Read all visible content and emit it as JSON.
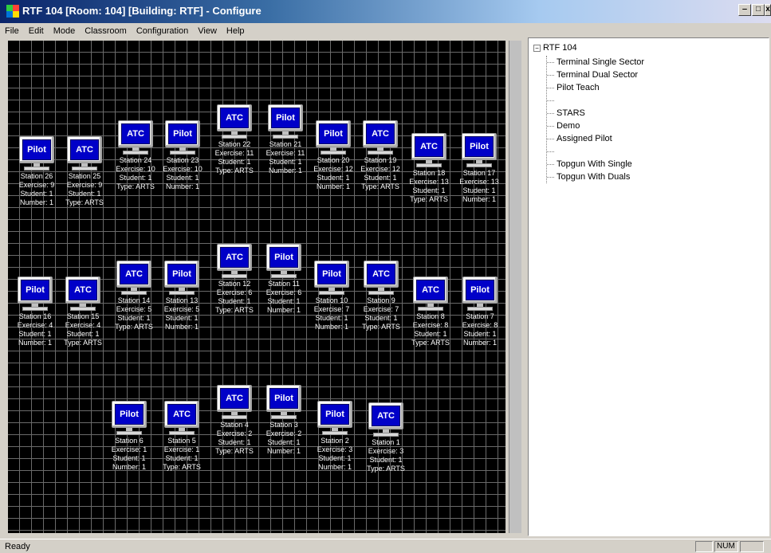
{
  "window": {
    "title": "RTF 104 [Room: 104] [Building: RTF] - Configure"
  },
  "menu": [
    "File",
    "Edit",
    "Mode",
    "Classroom",
    "Configuration",
    "View",
    "Help"
  ],
  "colors": {
    "screen": "#0000c8",
    "grid_background": "#000000",
    "grid_lines": "#6a6a6a"
  },
  "stations": [
    {
      "label": "Pilot",
      "name": "Station 26",
      "line1": "Exercise: 9",
      "line2": "Student: 1",
      "line3": "Number: 1"
    },
    {
      "label": "ATC",
      "name": "Station 25",
      "line1": "Exercise: 9",
      "line2": "Student: 1",
      "line3": "Type: ARTS"
    },
    {
      "label": "ATC",
      "name": "Station 24",
      "line1": "Exercise: 10",
      "line2": "Student: 1",
      "line3": "Type: ARTS"
    },
    {
      "label": "Pilot",
      "name": "Station 23",
      "line1": "Exercise: 10",
      "line2": "Student: 1",
      "line3": "Number: 1"
    },
    {
      "label": "ATC",
      "name": "Station 22",
      "line1": "Exercise: 11",
      "line2": "Student: 1",
      "line3": "Type: ARTS"
    },
    {
      "label": "Pilot",
      "name": "Station 21",
      "line1": "Exercise: 11",
      "line2": "Student: 1",
      "line3": "Number: 1"
    },
    {
      "label": "Pilot",
      "name": "Station 20",
      "line1": "Exercise: 12",
      "line2": "Student: 1",
      "line3": "Number: 1"
    },
    {
      "label": "ATC",
      "name": "Station 19",
      "line1": "Exercise: 12",
      "line2": "Student: 1",
      "line3": "Type: ARTS"
    },
    {
      "label": "ATC",
      "name": "Station 18",
      "line1": "Exercise: 13",
      "line2": "Student: 1",
      "line3": "Type: ARTS"
    },
    {
      "label": "Pilot",
      "name": "Station 17",
      "line1": "Exercise: 13",
      "line2": "Student: 1",
      "line3": "Number: 1"
    },
    {
      "label": "Pilot",
      "name": "Station 16",
      "line1": "Exercise: 4",
      "line2": "Student: 1",
      "line3": "Number: 1"
    },
    {
      "label": "ATC",
      "name": "Station 15",
      "line1": "Exercise: 4",
      "line2": "Student: 1",
      "line3": "Type: ARTS"
    },
    {
      "label": "ATC",
      "name": "Station 14",
      "line1": "Exercise: 5",
      "line2": "Student: 1",
      "line3": "Type: ARTS"
    },
    {
      "label": "Pilot",
      "name": "Station 13",
      "line1": "Exercise: 5",
      "line2": "Student: 1",
      "line3": "Number: 1"
    },
    {
      "label": "ATC",
      "name": "Station 12",
      "line1": "Exercise: 6",
      "line2": "Student: 1",
      "line3": "Type: ARTS"
    },
    {
      "label": "Pilot",
      "name": "Station 11",
      "line1": "Exercise: 6",
      "line2": "Student: 1",
      "line3": "Number: 1"
    },
    {
      "label": "Pilot",
      "name": "Station 10",
      "line1": "Exercise: 7",
      "line2": "Student: 1",
      "line3": "Number: 1"
    },
    {
      "label": "ATC",
      "name": "Station 9",
      "line1": "Exercise: 7",
      "line2": "Student: 1",
      "line3": "Type: ARTS"
    },
    {
      "label": "ATC",
      "name": "Station 8",
      "line1": "Exercise: 8",
      "line2": "Student: 1",
      "line3": "Type: ARTS"
    },
    {
      "label": "Pilot",
      "name": "Station 7",
      "line1": "Exercise: 8",
      "line2": "Student: 1",
      "line3": "Number: 1"
    },
    {
      "label": "Pilot",
      "name": "Station 6",
      "line1": "Exercise: 1",
      "line2": "Student: 1",
      "line3": "Number: 1"
    },
    {
      "label": "ATC",
      "name": "Station 5",
      "line1": "Exercise: 1",
      "line2": "Student: 1",
      "line3": "Type: ARTS"
    },
    {
      "label": "ATC",
      "name": "Station 4",
      "line1": "Exercise: 2",
      "line2": "Student: 1",
      "line3": "Type: ARTS"
    },
    {
      "label": "Pilot",
      "name": "Station 3",
      "line1": "Exercise: 2",
      "line2": "Student: 1",
      "line3": "Number: 1"
    },
    {
      "label": "Pilot",
      "name": "Station 2",
      "line1": "Exercise: 3",
      "line2": "Student: 1",
      "line3": "Number: 1"
    },
    {
      "label": "ATC",
      "name": "Station 1",
      "line1": "Exercise: 3",
      "line2": "Student: 1",
      "line3": "Type: ARTS"
    }
  ],
  "tree": {
    "root": "RTF 104",
    "items": [
      "Terminal Single Sector",
      "Terminal Dual Sector",
      "Pilot Teach",
      "",
      "STARS",
      "Demo",
      "Assigned Pilot",
      "",
      "Topgun With Single",
      "Topgun With Duals"
    ]
  },
  "status": {
    "text": "Ready",
    "num": "NUM"
  }
}
